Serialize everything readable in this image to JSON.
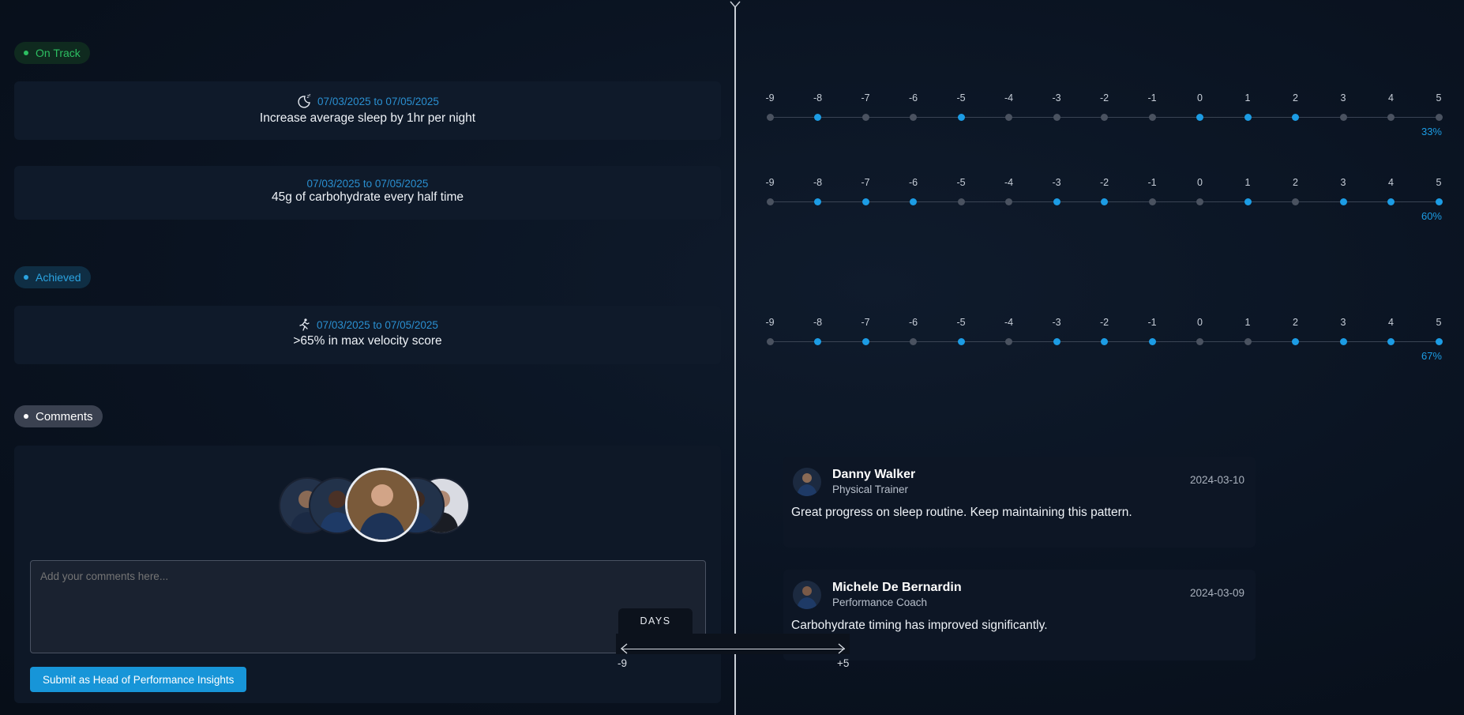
{
  "sections": {
    "on_track": "On Track",
    "achieved": "Achieved",
    "comments": "Comments"
  },
  "goals": [
    {
      "dates": "07/03/2025 to 07/05/2025",
      "title": "Increase average sleep by 1hr per night",
      "icon": "sleep-moon-icon",
      "active": [
        -8,
        -5,
        0,
        1,
        2
      ],
      "percent": "33%"
    },
    {
      "dates": "07/03/2025 to 07/05/2025",
      "title": "45g of carbohydrate every half time",
      "icon": null,
      "active": [
        -8,
        -7,
        -6,
        -3,
        -2,
        1,
        3,
        4,
        5
      ],
      "percent": "60%"
    },
    {
      "dates": "07/03/2025 to 07/05/2025",
      "title": ">65% in max velocity score",
      "icon": "running-person-icon",
      "active": [
        -8,
        -7,
        -5,
        -3,
        -2,
        -1,
        2,
        3,
        4,
        5
      ],
      "percent": "67%"
    }
  ],
  "timeline_ticks": [
    "-9",
    "-8",
    "-7",
    "-6",
    "-5",
    "-4",
    "-3",
    "-2",
    "-1",
    "0",
    "1",
    "2",
    "3",
    "4",
    "5"
  ],
  "comment_form": {
    "placeholder": "Add your comments here...",
    "submit_label": "Submit as Head of Performance Insights"
  },
  "comments": [
    {
      "name": "Danny Walker",
      "role": "Physical Trainer",
      "date": "2024-03-10",
      "text": "Great progress on sleep routine. Keep maintaining this pattern."
    },
    {
      "name": "Michele De Bernardin",
      "role": "Performance Coach",
      "date": "2024-03-09",
      "text": "Carbohydrate timing has improved significantly."
    }
  ],
  "days_control": {
    "label": "DAYS",
    "min": "-9",
    "max": "+5"
  },
  "colors": {
    "accent": "#1c9ce4",
    "on_track": "#2dbf62",
    "background": "#0a1321"
  }
}
